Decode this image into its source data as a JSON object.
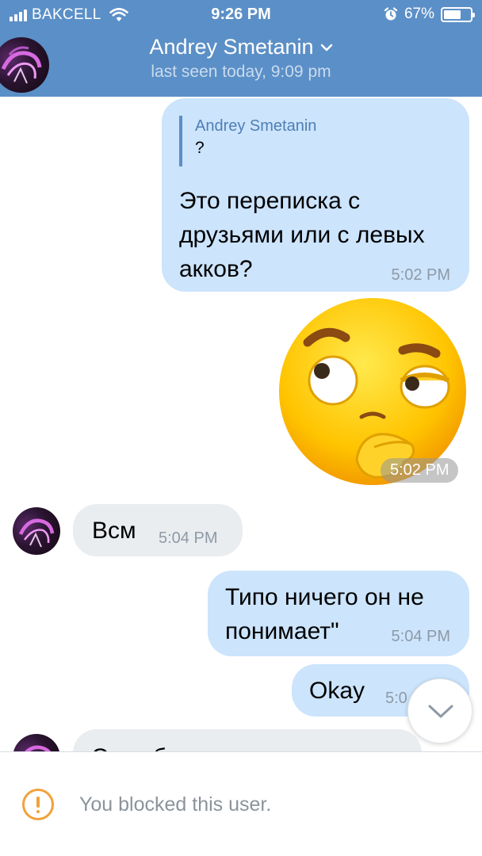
{
  "status_bar": {
    "carrier": "BAKCELL",
    "time": "9:26 PM",
    "battery_percent": "67%",
    "battery_level": 0.67
  },
  "header": {
    "contact_name": "Andrey Smetanin",
    "last_seen": "last seen today, 9:09 pm",
    "back_icon": "chevron-left-icon",
    "dropdown_icon": "chevron-down-icon"
  },
  "messages": [
    {
      "direction": "outgoing",
      "reply": {
        "author": "Andrey Smetanin",
        "text": "?"
      },
      "lines": [
        "Это переписка с",
        "друзьями или с левых",
        "акков?"
      ],
      "time": "5:02 PM"
    },
    {
      "direction": "outgoing",
      "type": "sticker",
      "sticker": "thinking-face-sticker",
      "time": "5:02 PM"
    },
    {
      "direction": "incoming",
      "text": "Всм",
      "time": "5:04 PM"
    },
    {
      "direction": "outgoing",
      "lines": [
        "Типо ничего он не",
        "понимает\""
      ],
      "time": "5:04 PM"
    },
    {
      "direction": "outgoing",
      "text": "Okay",
      "time": "5:0"
    },
    {
      "direction": "incoming",
      "text": "Это обычные люди"
    }
  ],
  "footer": {
    "notice": "You blocked this user.",
    "icon": "alert-circle-icon"
  },
  "colors": {
    "header_bg": "#5b8fc7",
    "outgoing_bubble": "#cce4fc",
    "incoming_bubble": "#eaedf0",
    "warning": "#f0a23c"
  }
}
